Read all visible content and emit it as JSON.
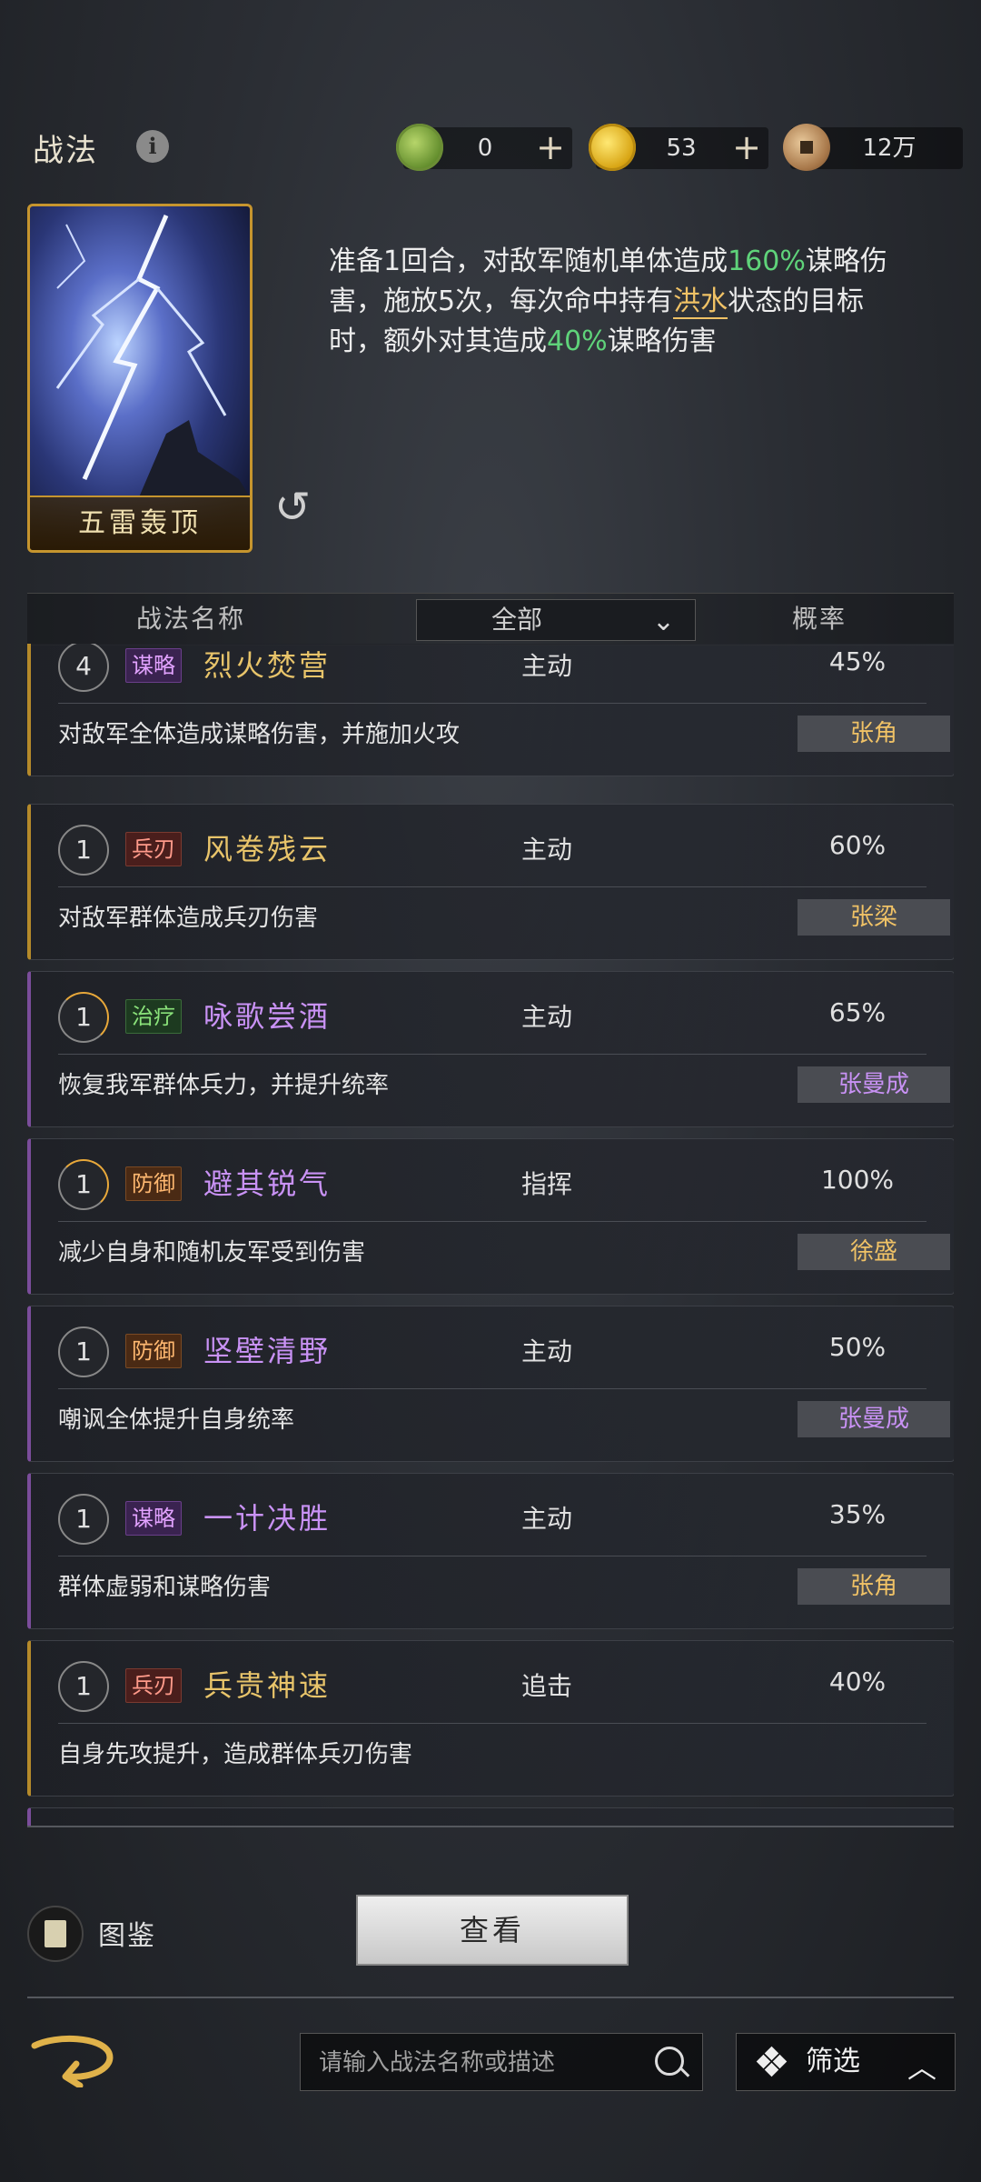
{
  "header": {
    "title": "战法",
    "resources": [
      {
        "icon": "jade-coin-icon",
        "value": "0",
        "has_plus": true
      },
      {
        "icon": "gold-coin-icon",
        "value": "53",
        "has_plus": true
      },
      {
        "icon": "copper-coin-icon",
        "value": "12万",
        "has_plus": false
      }
    ]
  },
  "selected_skill": {
    "name": "五雷轰顶",
    "desc_parts": {
      "p1": "准备1回合，对敌军随机单体造成",
      "v1": "160%",
      "p2": "谋略伤害，施放5次，每次命中持有",
      "k1": "洪水",
      "p3": "状态的目标时，额外对其造成",
      "v2": "40%",
      "p4": "谋略伤害"
    }
  },
  "table_header": {
    "name_col": "战法名称",
    "filter_value": "全部",
    "prob_col": "概率"
  },
  "skills": [
    {
      "level": "4",
      "tag": "谋略",
      "name": "烈火焚营",
      "type": "主动",
      "prob": "45%",
      "desc": "对敌军全体造成谋略伤害，并施加火攻",
      "hero": "张角"
    },
    {
      "level": "1",
      "tag": "兵刃",
      "name": "风卷残云",
      "type": "主动",
      "prob": "60%",
      "desc": "对敌军群体造成兵刃伤害",
      "hero": "张梁"
    },
    {
      "level": "1",
      "tag": "治疗",
      "name": "咏歌尝酒",
      "type": "主动",
      "prob": "65%",
      "desc": "恢复我军群体兵力，并提升统率",
      "hero": "张曼成"
    },
    {
      "level": "1",
      "tag": "防御",
      "name": "避其锐气",
      "type": "指挥",
      "prob": "100%",
      "desc": "减少自身和随机友军受到伤害",
      "hero": "徐盛"
    },
    {
      "level": "1",
      "tag": "防御",
      "name": "坚壁清野",
      "type": "主动",
      "prob": "50%",
      "desc": "嘲讽全体提升自身统率",
      "hero": "张曼成"
    },
    {
      "level": "1",
      "tag": "谋略",
      "name": "一计决胜",
      "type": "主动",
      "prob": "35%",
      "desc": "群体虚弱和谋略伤害",
      "hero": "张角"
    },
    {
      "level": "1",
      "tag": "兵刃",
      "name": "兵贵神速",
      "type": "追击",
      "prob": "40%",
      "desc": "自身先攻提升，造成群体兵刃伤害",
      "hero": ""
    }
  ],
  "bottom": {
    "book_label": "图鉴",
    "view_button": "查看",
    "search_placeholder": "请输入战法名称或描述",
    "filter_label": "筛选"
  }
}
